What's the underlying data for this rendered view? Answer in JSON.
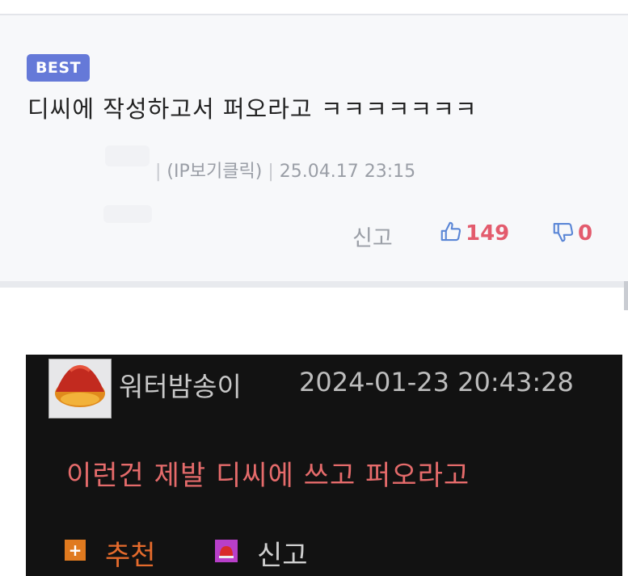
{
  "best_comment": {
    "badge": "BEST",
    "text": "디씨에 작성하고서 퍼오라고 ㅋㅋㅋㅋㅋㅋㅋ",
    "author_ip": "(IP보기클릭)",
    "timestamp": "25.04.17 23:15",
    "report_label": "신고",
    "likes": "149",
    "dislikes": "0"
  },
  "dc_comment": {
    "username": "워터밤송이",
    "timestamp": "2024-01-23 20:43:28",
    "text": "이런건 제발 디씨에 쓰고 퍼오라고",
    "recommend_icon": "+",
    "recommend_label": "추천",
    "report_label": "신고"
  },
  "colors": {
    "badge": "#6579d8",
    "likes": "#e35b6d",
    "dc_comment_text": "#e56b6b",
    "dc_recommend": "#e56b2c"
  }
}
